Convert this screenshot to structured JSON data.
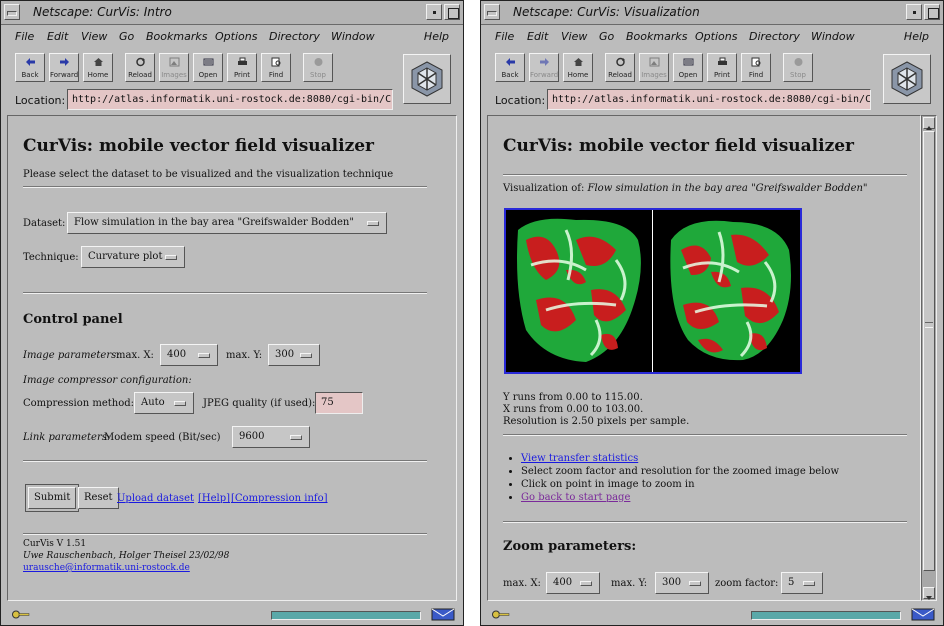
{
  "menu": [
    "File",
    "Edit",
    "View",
    "Go",
    "Bookmarks",
    "Options",
    "Directory",
    "Window"
  ],
  "menu_help": "Help",
  "colors": {
    "window_bg": "#bcbcbc",
    "field_bg": "#e4c6c6",
    "link": "#1a1ae0",
    "visited": "#7a2a9a",
    "progress": "#5aa8a8"
  },
  "win1": {
    "title": "Netscape: CurVis: Intro",
    "toolbar": [
      {
        "label": "Back",
        "icon": "back-arrow-icon",
        "dim": false
      },
      {
        "label": "Forward",
        "icon": "forward-arrow-icon",
        "dim": false
      },
      {
        "label": "Home",
        "icon": "home-icon",
        "dim": false
      },
      {
        "label": "Reload",
        "icon": "reload-icon",
        "dim": false
      },
      {
        "label": "Images",
        "icon": "images-icon",
        "dim": true
      },
      {
        "label": "Open",
        "icon": "open-icon",
        "dim": false
      },
      {
        "label": "Print",
        "icon": "print-icon",
        "dim": false
      },
      {
        "label": "Find",
        "icon": "find-icon",
        "dim": false
      },
      {
        "label": "Stop",
        "icon": "stop-icon",
        "dim": true
      }
    ],
    "location_label": "Location:",
    "location_url": "http://atlas.informatik.uni-rostock.de:8080/cgi-bin/Cu",
    "page": {
      "heading": "CurVis: mobile vector field visualizer",
      "intro": "Please select the dataset to be visualized and the visualization technique",
      "dataset_label": "Dataset:",
      "dataset_value": "Flow simulation in the bay area \"Greifswalder Bodden\"",
      "technique_label": "Technique:",
      "technique_value": "Curvature plot",
      "control_heading": "Control panel",
      "image_params_label": "Image parameters:",
      "maxx_label": "max. X:",
      "maxx_value": "400",
      "maxy_label": "max. Y:",
      "maxy_value": "300",
      "compressor_label": "Image compressor configuration:",
      "compression_label": "Compression method:",
      "compression_value": "Auto",
      "jpeg_label": "JPEG quality (if used):",
      "jpeg_value": "75",
      "link_params_label": "Link parameters:",
      "modem_label": "Modem speed (Bit/sec)",
      "modem_value": "9600",
      "submit": "Submit",
      "reset": "Reset",
      "upload_link": "Upload dataset",
      "help_link": "[Help]",
      "compression_info_link": "[Compression info]",
      "version": "CurVis V 1.51",
      "authors": "Uwe Rauschenbach, Holger Theisel 23/02/98",
      "email": "urausche@informatik.uni-rostock.de"
    }
  },
  "win2": {
    "title": "Netscape: CurVis: Visualization",
    "toolbar": [
      {
        "label": "Back",
        "icon": "back-arrow-icon",
        "dim": false
      },
      {
        "label": "Forward",
        "icon": "forward-arrow-icon",
        "dim": true
      },
      {
        "label": "Home",
        "icon": "home-icon",
        "dim": false
      },
      {
        "label": "Reload",
        "icon": "reload-icon",
        "dim": false
      },
      {
        "label": "Images",
        "icon": "images-icon",
        "dim": true
      },
      {
        "label": "Open",
        "icon": "open-icon",
        "dim": false
      },
      {
        "label": "Print",
        "icon": "print-icon",
        "dim": false
      },
      {
        "label": "Find",
        "icon": "find-icon",
        "dim": false
      },
      {
        "label": "Stop",
        "icon": "stop-icon",
        "dim": true
      }
    ],
    "location_label": "Location:",
    "location_url": "http://atlas.informatik.uni-rostock.de:8080/cgi-bin/Cu",
    "page": {
      "heading": "CurVis: mobile vector field visualizer",
      "viz_label": "Visualization of:",
      "viz_value": "Flow simulation in the bay area \"Greifswalder Bodden\"",
      "y_runs": "Y runs from 0.00 to 115.00.",
      "x_runs": "X runs from 0.00 to 103.00.",
      "resolution": "Resolution is 2.50 pixels per sample.",
      "bullet_stats": "View transfer statistics",
      "bullet_select": "Select zoom factor and resolution for the zoomed image below",
      "bullet_click": "Click on point in image to zoom in",
      "bullet_back": "Go back to start page",
      "zoom_heading": "Zoom parameters:",
      "maxx_label": "max. X:",
      "maxx_value": "400",
      "maxy_label": "max. Y:",
      "maxy_value": "300",
      "zoom_label": "zoom factor:",
      "zoom_value": "5"
    }
  }
}
